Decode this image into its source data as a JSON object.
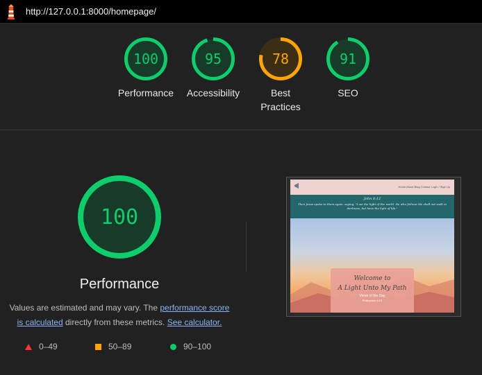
{
  "browser": {
    "url": "http://127.0.0.1:8000/homepage/"
  },
  "scores": [
    {
      "label": "Performance",
      "value": "100",
      "score": 100,
      "color": "#0cce6b"
    },
    {
      "label": "Accessibility",
      "value": "95",
      "score": 95,
      "color": "#0cce6b"
    },
    {
      "label": "Best Practices",
      "value": "78",
      "score": 78,
      "color": "#ffa400"
    },
    {
      "label": "SEO",
      "value": "91",
      "score": 91,
      "color": "#0cce6b"
    }
  ],
  "performance": {
    "score": "100",
    "title": "Performance",
    "note_prefix": "Values are estimated and may vary. The ",
    "note_link1": "performance score is calculated",
    "note_mid": " directly from these metrics. ",
    "note_link2": "See calculator."
  },
  "legend": {
    "poor": "0–49",
    "average": "50–89",
    "good": "90–100"
  },
  "screenshot": {
    "nav_links": "Home   About   Blog   Contact   Login / Sign Up",
    "verse_ref": "John 8:12",
    "verse_text": "Then Jesus spoke to them again, saying, \"I am the light of the world. He who follows Me shall not walk in darkness, but have the light of life.\"",
    "welcome_line1": "Welcome to",
    "welcome_line2": "A Light Unto My Path",
    "votd": "Verse of the Day",
    "votd_ref": "Philippians 4:13"
  },
  "colors": {
    "good": "#0cce6b",
    "average": "#ffa400",
    "poor": "#ff3333"
  }
}
